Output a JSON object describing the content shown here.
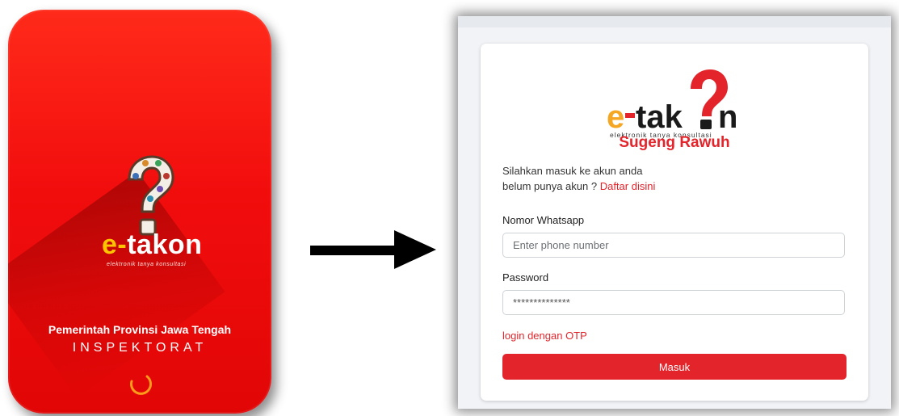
{
  "splash": {
    "logo": {
      "prefix": "e-",
      "name": "takon",
      "tagline": "elektronik tanya konsultasi"
    },
    "government": "Pemerintah Provinsi Jawa Tengah",
    "department": "INSPEKTORAT",
    "loading_icon": "spinner-icon",
    "colors": {
      "background": "#f20d0d",
      "accent": "#ffc400"
    }
  },
  "transition": {
    "icon": "arrow-right-icon"
  },
  "login": {
    "logo": {
      "prefix": "e-",
      "name_start": "tak",
      "name_end": "n",
      "tagline": "elektronik tanya konsultasi"
    },
    "welcome": "Sugeng Rawuh",
    "intro_line1": "Silahkan masuk ke akun anda",
    "intro_line2_prefix": "belum punya akun ? ",
    "register_link": "Daftar disini",
    "phone_label": "Nomor Whatsapp",
    "phone_placeholder": "Enter phone number",
    "password_label": "Password",
    "password_value": "**************",
    "otp_link": "login dengan OTP",
    "submit_label": "Masuk",
    "colors": {
      "primary": "#e3242b",
      "logo_orange": "#f5a623",
      "logo_dark": "#1a1a1a"
    }
  }
}
